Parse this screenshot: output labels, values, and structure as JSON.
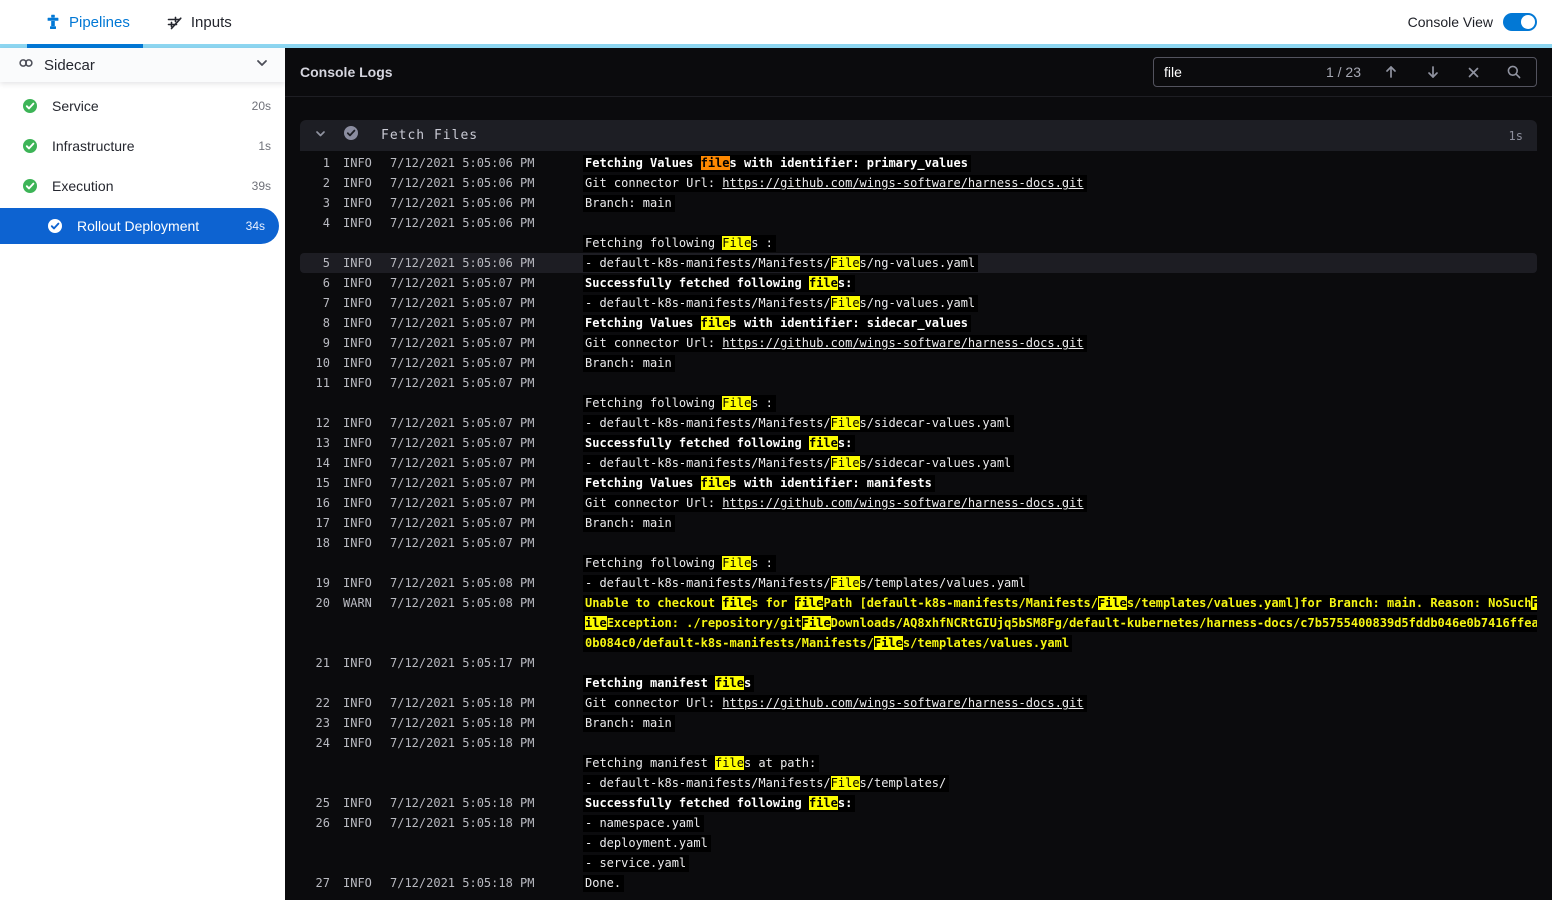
{
  "topbar": {
    "tabs": [
      {
        "label": "Pipelines",
        "active": true
      },
      {
        "label": "Inputs",
        "active": false
      }
    ],
    "console_view_label": "Console View",
    "toggle_on": true,
    "accent_color": "#0278d5",
    "strip_color": "#8dd6f1"
  },
  "sidebar": {
    "title": "Sidecar",
    "items": [
      {
        "label": "Service",
        "duration": "20s",
        "status": "success",
        "selected": false,
        "indent": false
      },
      {
        "label": "Infrastructure",
        "duration": "1s",
        "status": "success",
        "selected": false,
        "indent": false
      },
      {
        "label": "Execution",
        "duration": "39s",
        "status": "success",
        "selected": false,
        "indent": false
      },
      {
        "label": "Rollout Deployment",
        "duration": "34s",
        "status": "success",
        "selected": true,
        "indent": true
      }
    ],
    "success_color": "#3db457",
    "selected_color": "#0d63d1"
  },
  "console": {
    "title": "Console Logs",
    "search": {
      "value": "file",
      "counter": "1 / 23"
    },
    "section": {
      "title": "Fetch Files",
      "duration": "1s"
    },
    "highlight_colors": {
      "match": "#fdfd00",
      "current": "#ff8800",
      "warn_text": "#f5f513"
    },
    "logs": [
      {
        "num": "1",
        "level": "INFO",
        "time": "7/12/2021 5:05:06 PM",
        "bold": true,
        "segs": [
          {
            "t": "Fetching Values "
          },
          {
            "t": "file",
            "m": "cur"
          },
          {
            "t": "s with identifier: primary_values"
          }
        ]
      },
      {
        "num": "2",
        "level": "INFO",
        "time": "7/12/2021 5:05:06 PM",
        "segs": [
          {
            "t": "Git connector Url: "
          },
          {
            "t": "https://github.com/wings-software/harness-docs.git",
            "m": "link"
          }
        ]
      },
      {
        "num": "3",
        "level": "INFO",
        "time": "7/12/2021 5:05:06 PM",
        "segs": [
          {
            "t": "Branch: main"
          }
        ]
      },
      {
        "num": "4",
        "level": "INFO",
        "time": "7/12/2021 5:05:06 PM",
        "segs": []
      },
      {
        "segs": [
          {
            "t": "Fetching following "
          },
          {
            "t": "File",
            "m": "hl"
          },
          {
            "t": "s :"
          }
        ]
      },
      {
        "num": "5",
        "level": "INFO",
        "time": "7/12/2021 5:05:06 PM",
        "selected": true,
        "segs": [
          {
            "t": "- default-k8s-manifests/Manifests/"
          },
          {
            "t": "File",
            "m": "hl"
          },
          {
            "t": "s/ng-values.yaml"
          }
        ]
      },
      {
        "num": "6",
        "level": "INFO",
        "time": "7/12/2021 5:05:07 PM",
        "bold": true,
        "segs": [
          {
            "t": "Successfully fetched following "
          },
          {
            "t": "file",
            "m": "hl"
          },
          {
            "t": "s:"
          }
        ]
      },
      {
        "num": "7",
        "level": "INFO",
        "time": "7/12/2021 5:05:07 PM",
        "segs": [
          {
            "t": "- default-k8s-manifests/Manifests/"
          },
          {
            "t": "File",
            "m": "hl"
          },
          {
            "t": "s/ng-values.yaml"
          }
        ]
      },
      {
        "num": "8",
        "level": "INFO",
        "time": "7/12/2021 5:05:07 PM",
        "bold": true,
        "segs": [
          {
            "t": "Fetching Values "
          },
          {
            "t": "file",
            "m": "hl"
          },
          {
            "t": "s with identifier: sidecar_values"
          }
        ]
      },
      {
        "num": "9",
        "level": "INFO",
        "time": "7/12/2021 5:05:07 PM",
        "segs": [
          {
            "t": "Git connector Url: "
          },
          {
            "t": "https://github.com/wings-software/harness-docs.git",
            "m": "link"
          }
        ]
      },
      {
        "num": "10",
        "level": "INFO",
        "time": "7/12/2021 5:05:07 PM",
        "segs": [
          {
            "t": "Branch: main"
          }
        ]
      },
      {
        "num": "11",
        "level": "INFO",
        "time": "7/12/2021 5:05:07 PM",
        "segs": []
      },
      {
        "segs": [
          {
            "t": "Fetching following "
          },
          {
            "t": "File",
            "m": "hl"
          },
          {
            "t": "s :"
          }
        ]
      },
      {
        "num": "12",
        "level": "INFO",
        "time": "7/12/2021 5:05:07 PM",
        "segs": [
          {
            "t": "- default-k8s-manifests/Manifests/"
          },
          {
            "t": "File",
            "m": "hl"
          },
          {
            "t": "s/sidecar-values.yaml"
          }
        ]
      },
      {
        "num": "13",
        "level": "INFO",
        "time": "7/12/2021 5:05:07 PM",
        "bold": true,
        "segs": [
          {
            "t": "Successfully fetched following "
          },
          {
            "t": "file",
            "m": "hl"
          },
          {
            "t": "s:"
          }
        ]
      },
      {
        "num": "14",
        "level": "INFO",
        "time": "7/12/2021 5:05:07 PM",
        "segs": [
          {
            "t": "- default-k8s-manifests/Manifests/"
          },
          {
            "t": "File",
            "m": "hl"
          },
          {
            "t": "s/sidecar-values.yaml"
          }
        ]
      },
      {
        "num": "15",
        "level": "INFO",
        "time": "7/12/2021 5:05:07 PM",
        "bold": true,
        "segs": [
          {
            "t": "Fetching Values "
          },
          {
            "t": "file",
            "m": "hl"
          },
          {
            "t": "s with identifier: manifests"
          }
        ]
      },
      {
        "num": "16",
        "level": "INFO",
        "time": "7/12/2021 5:05:07 PM",
        "segs": [
          {
            "t": "Git connector Url: "
          },
          {
            "t": "https://github.com/wings-software/harness-docs.git",
            "m": "link"
          }
        ]
      },
      {
        "num": "17",
        "level": "INFO",
        "time": "7/12/2021 5:05:07 PM",
        "segs": [
          {
            "t": "Branch: main"
          }
        ]
      },
      {
        "num": "18",
        "level": "INFO",
        "time": "7/12/2021 5:05:07 PM",
        "segs": []
      },
      {
        "segs": [
          {
            "t": "Fetching following "
          },
          {
            "t": "File",
            "m": "hl"
          },
          {
            "t": "s :"
          }
        ]
      },
      {
        "num": "19",
        "level": "INFO",
        "time": "7/12/2021 5:05:08 PM",
        "segs": [
          {
            "t": "- default-k8s-manifests/Manifests/"
          },
          {
            "t": "File",
            "m": "hl"
          },
          {
            "t": "s/templates/values.yaml"
          }
        ]
      },
      {
        "num": "20",
        "level": "WARN",
        "time": "7/12/2021 5:05:08 PM",
        "warn": true,
        "segs": [
          {
            "t": "Unable to checkout "
          },
          {
            "t": "file",
            "m": "hl"
          },
          {
            "t": "s for "
          },
          {
            "t": "file",
            "m": "hl"
          },
          {
            "t": "Path [default-k8s-manifests/Manifests/"
          },
          {
            "t": "File",
            "m": "hl"
          },
          {
            "t": "s/templates/values.yaml]for Branch: main. Reason: NoSuch"
          },
          {
            "t": "F",
            "m": "hl"
          }
        ]
      },
      {
        "warn": true,
        "segs": [
          {
            "t": "ile",
            "m": "hl"
          },
          {
            "t": "Exception: ./repository/git"
          },
          {
            "t": "File",
            "m": "hl"
          },
          {
            "t": "Downloads/AQ8xhfNCRtGIUjq5bSM8Fg/default-kubernetes/harness-docs/c7b5755400839d5fddb046e0b7416ffea"
          }
        ]
      },
      {
        "warn": true,
        "segs": [
          {
            "t": "0b084c0/default-k8s-manifests/Manifests/"
          },
          {
            "t": "File",
            "m": "hl"
          },
          {
            "t": "s/templates/values.yaml"
          }
        ]
      },
      {
        "num": "21",
        "level": "INFO",
        "time": "7/12/2021 5:05:17 PM",
        "segs": []
      },
      {
        "bold": true,
        "segs": [
          {
            "t": "Fetching manifest "
          },
          {
            "t": "file",
            "m": "hl"
          },
          {
            "t": "s"
          }
        ]
      },
      {
        "num": "22",
        "level": "INFO",
        "time": "7/12/2021 5:05:18 PM",
        "segs": [
          {
            "t": "Git connector Url: "
          },
          {
            "t": "https://github.com/wings-software/harness-docs.git",
            "m": "link"
          }
        ]
      },
      {
        "num": "23",
        "level": "INFO",
        "time": "7/12/2021 5:05:18 PM",
        "segs": [
          {
            "t": "Branch: main"
          }
        ]
      },
      {
        "num": "24",
        "level": "INFO",
        "time": "7/12/2021 5:05:18 PM",
        "segs": []
      },
      {
        "segs": [
          {
            "t": "Fetching manifest "
          },
          {
            "t": "file",
            "m": "hl"
          },
          {
            "t": "s at path:"
          }
        ]
      },
      {
        "segs": [
          {
            "t": "- default-k8s-manifests/Manifests/"
          },
          {
            "t": "File",
            "m": "hl"
          },
          {
            "t": "s/templates/"
          }
        ]
      },
      {
        "num": "25",
        "level": "INFO",
        "time": "7/12/2021 5:05:18 PM",
        "bold": true,
        "segs": [
          {
            "t": "Successfully fetched following "
          },
          {
            "t": "file",
            "m": "hl"
          },
          {
            "t": "s:"
          }
        ]
      },
      {
        "num": "26",
        "level": "INFO",
        "time": "7/12/2021 5:05:18 PM",
        "segs": [
          {
            "t": "- namespace.yaml"
          }
        ]
      },
      {
        "segs": [
          {
            "t": "- deployment.yaml"
          }
        ]
      },
      {
        "segs": [
          {
            "t": "- service.yaml"
          }
        ]
      },
      {
        "num": "27",
        "level": "INFO",
        "time": "7/12/2021 5:05:18 PM",
        "segs": [
          {
            "t": "Done."
          }
        ]
      }
    ]
  },
  "icons": {
    "pipelines": "pipe-tee",
    "inputs": "sliders-pen",
    "sidebar_header": "link-rings",
    "collapse": "chevron-down",
    "step_status": "check-circle",
    "search_prev": "arrow-up",
    "search_next": "arrow-down",
    "search_clear": "close-x",
    "search": "magnifier"
  }
}
